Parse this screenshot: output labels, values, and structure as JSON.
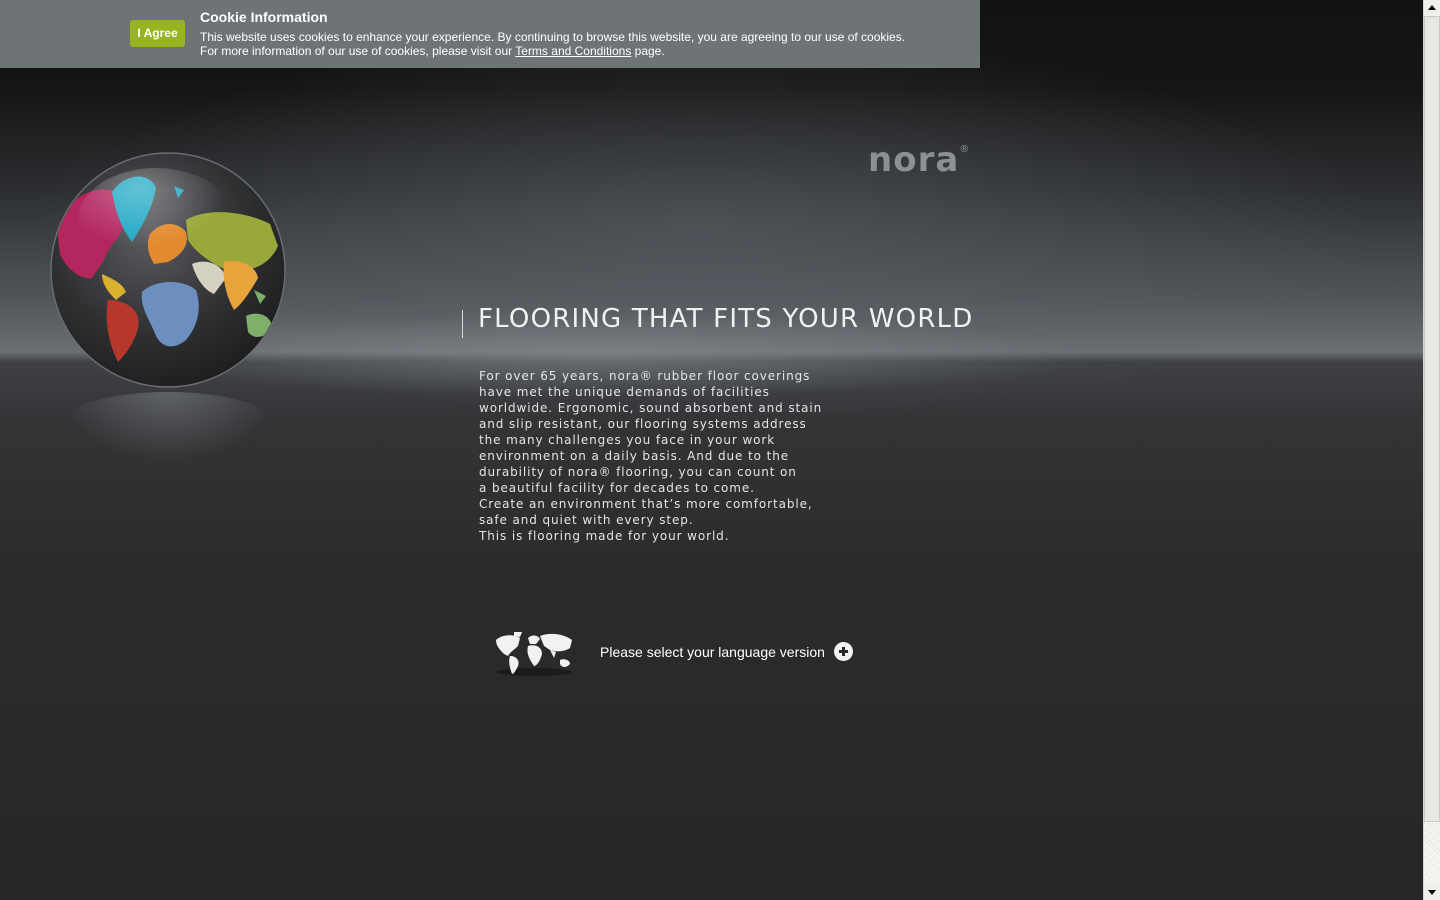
{
  "cookie_bar": {
    "title": "Cookie Information",
    "agree_label": "I Agree",
    "line1": "This website uses cookies to enhance your experience. By continuing to browse this website, you are agreeing to our use of cookies.",
    "line2_prefix": "For more information of our use of cookies, please visit our ",
    "line2_link": "Terms and Conditions",
    "line2_suffix": " page.",
    "background_color": "#6e7476",
    "button_color": "#97b520"
  },
  "logo": {
    "text": "nora",
    "mark": "®"
  },
  "hero": {
    "headline": "FLOORING THAT FITS YOUR WORLD",
    "body_lines": [
      "For over 65 years, nora® rubber floor coverings",
      "have met the unique demands of facilities",
      "worldwide. Ergonomic, sound absorbent and stain",
      "and slip resistant, our flooring systems address",
      "the many challenges you face in your work",
      "environment on a daily basis. And due to the",
      "durability of nora® flooring, you can count on",
      "a beautiful facility for decades to come.",
      "Create an environment that’s more comfortable,",
      "safe and quiet with every step.",
      "This is flooring made for your world."
    ]
  },
  "language": {
    "label": "Please select your language version",
    "button_icon": "plus-circle-icon",
    "map_icon": "world-map-icon"
  },
  "globe": {
    "icon": "colored-world-globe-icon",
    "continent_colors": {
      "north_america": "#b3265e",
      "greenland": "#1fa8c4",
      "south_america": "#b7372c",
      "europe": "#e38a2f",
      "africa": "#6d8fbf",
      "asia": "#9aa83b",
      "middle_east": "#d4d0c2",
      "india": "#e9a33b",
      "oceania": "#7fb06b"
    }
  }
}
